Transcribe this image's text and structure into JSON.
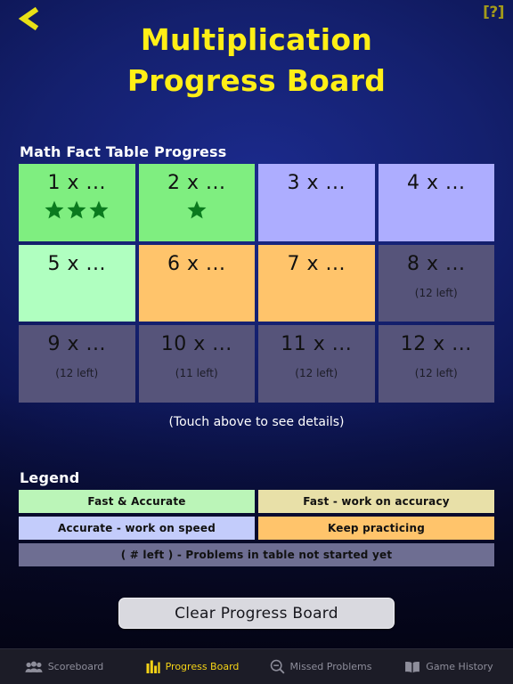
{
  "header": {
    "back_icon": "chevron-left-icon",
    "help_label": "[?]",
    "title_line1": "Multiplication",
    "title_line2": "Progress Board",
    "title_color": "#ffef16"
  },
  "table_section": {
    "label": "Math Fact Table Progress",
    "hint": "(Touch above to see details)",
    "cells": [
      {
        "label": "1 x ...",
        "status": "fast-accurate",
        "color": "#7FEE80",
        "stars": 3,
        "left": ""
      },
      {
        "label": "2 x ...",
        "status": "fast-accurate",
        "color": "#7FEE80",
        "stars": 1,
        "left": ""
      },
      {
        "label": "3 x ...",
        "status": "accurate-slow",
        "color": "#ADADFF",
        "stars": 0,
        "left": ""
      },
      {
        "label": "4 x ...",
        "status": "accurate-slow",
        "color": "#ADADFF",
        "stars": 0,
        "left": ""
      },
      {
        "label": "5 x ...",
        "status": "fast-accurate",
        "color": "#B0FFC0",
        "stars": 0,
        "left": ""
      },
      {
        "label": "6 x ...",
        "status": "keep-practicing",
        "color": "#FFC46B",
        "stars": 0,
        "left": ""
      },
      {
        "label": "7 x ...",
        "status": "keep-practicing",
        "color": "#FFC46B",
        "stars": 0,
        "left": ""
      },
      {
        "label": "8 x ...",
        "status": "not-started",
        "color": "#56547A",
        "stars": 0,
        "left": "(12 left)"
      },
      {
        "label": "9 x ...",
        "status": "not-started",
        "color": "#56547A",
        "stars": 0,
        "left": "(12 left)"
      },
      {
        "label": "10 x ...",
        "status": "not-started",
        "color": "#56547A",
        "stars": 0,
        "left": "(11 left)"
      },
      {
        "label": "11 x ...",
        "status": "not-started",
        "color": "#56547A",
        "stars": 0,
        "left": "(12 left)"
      },
      {
        "label": "12 x ...",
        "status": "not-started",
        "color": "#56547A",
        "stars": 0,
        "left": "(12 left)"
      }
    ],
    "star_color": "#0a7a1e"
  },
  "legend": {
    "label": "Legend",
    "items": [
      {
        "text": "Fast & Accurate",
        "color": "#BBF5B8",
        "width": "half"
      },
      {
        "text": "Fast - work on accuracy",
        "color": "#E8E0A8",
        "width": "half"
      },
      {
        "text": "Accurate - work on speed",
        "color": "#C3CCFB",
        "width": "half"
      },
      {
        "text": "Keep practicing",
        "color": "#FFC46B",
        "width": "half"
      },
      {
        "text": "( # left ) - Problems in table not started yet",
        "color": "#6E6E92",
        "width": "full"
      }
    ]
  },
  "clear_button": {
    "label": "Clear Progress Board"
  },
  "tabbar": {
    "active_color": "#f5d316",
    "inactive_color": "#8e8e9b",
    "tabs": [
      {
        "label": "Scoreboard",
        "icon": "people-icon",
        "active": false
      },
      {
        "label": "Progress Board",
        "icon": "bar-chart-icon",
        "active": true
      },
      {
        "label": "Missed Problems",
        "icon": "magnifier-minus-icon",
        "active": false
      },
      {
        "label": "Game History",
        "icon": "open-book-icon",
        "active": false
      }
    ]
  }
}
